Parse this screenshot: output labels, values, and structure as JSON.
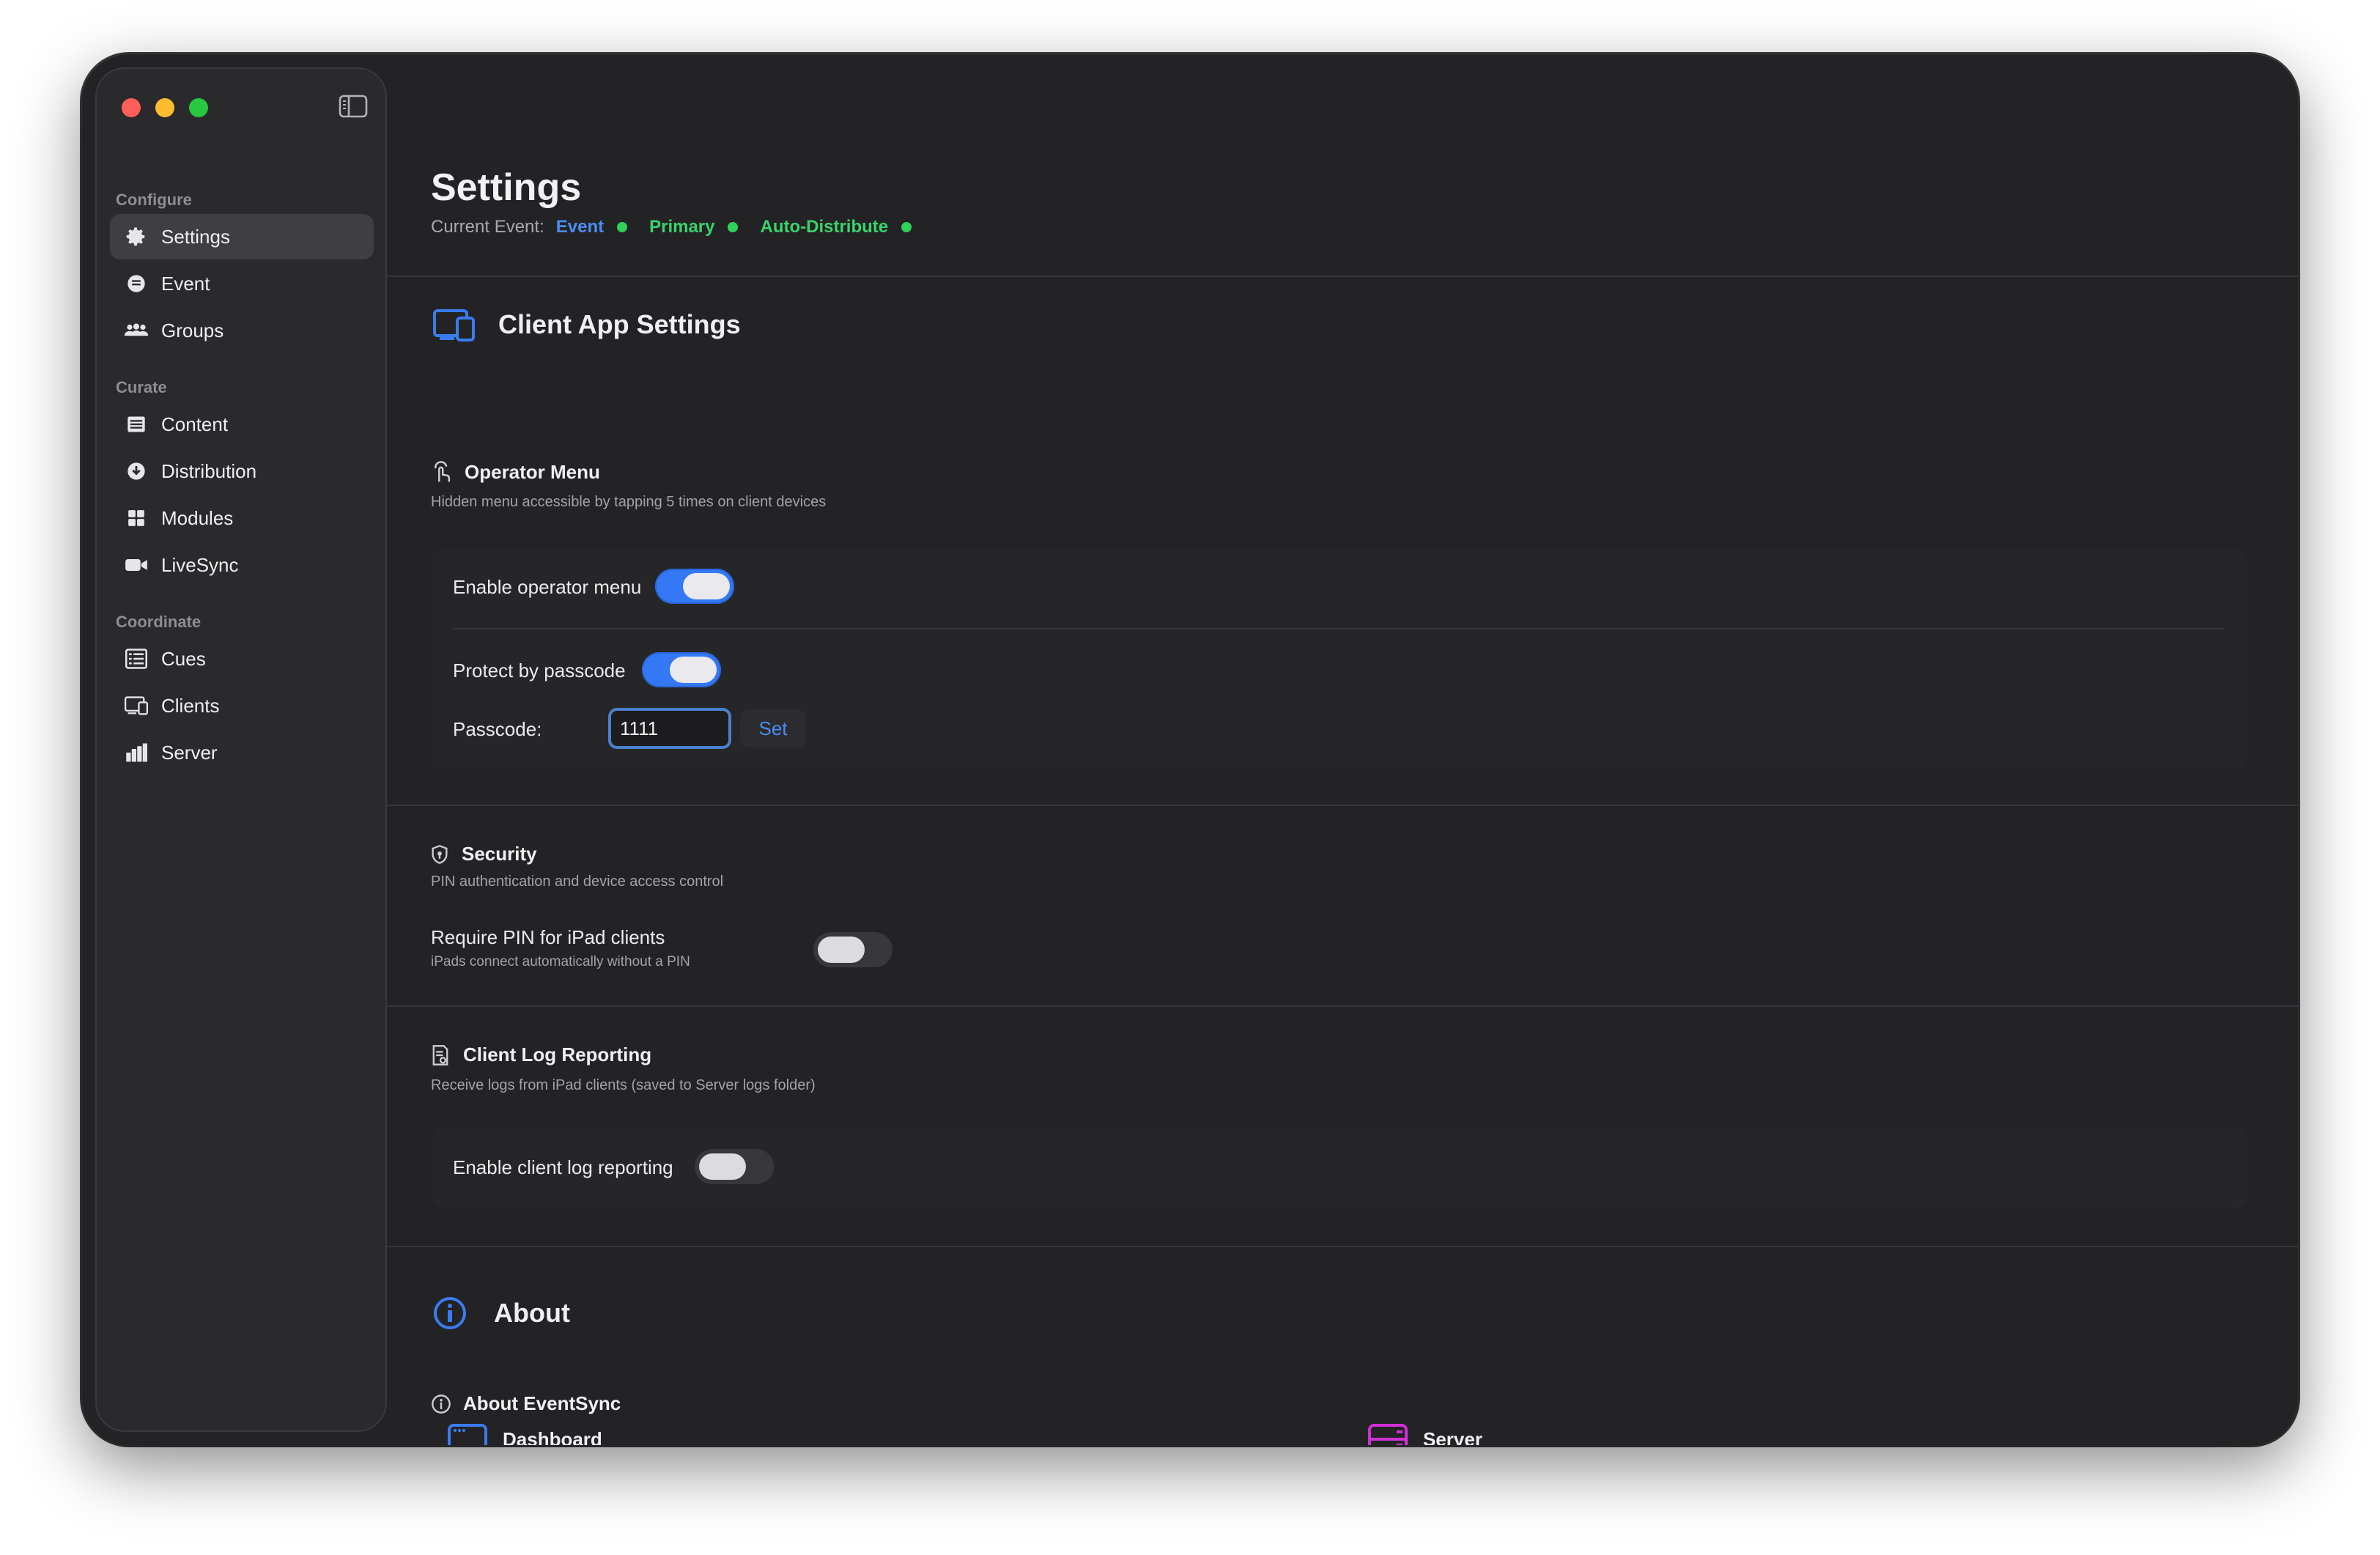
{
  "sidebar": {
    "sections": [
      {
        "label": "Configure",
        "items": [
          {
            "label": "Settings",
            "icon": "gear-icon",
            "active": true
          },
          {
            "label": "Event",
            "icon": "event-icon"
          },
          {
            "label": "Groups",
            "icon": "people-icon"
          }
        ]
      },
      {
        "label": "Curate",
        "items": [
          {
            "label": "Content",
            "icon": "content-icon"
          },
          {
            "label": "Distribution",
            "icon": "download-icon"
          },
          {
            "label": "Modules",
            "icon": "grid-icon"
          },
          {
            "label": "LiveSync",
            "icon": "video-icon"
          }
        ]
      },
      {
        "label": "Coordinate",
        "items": [
          {
            "label": "Cues",
            "icon": "list-icon"
          },
          {
            "label": "Clients",
            "icon": "clients-icon"
          },
          {
            "label": "Server",
            "icon": "chart-icon"
          }
        ]
      }
    ]
  },
  "header": {
    "title": "Settings",
    "current_event_label": "Current Event:",
    "tags": [
      {
        "text": "Event",
        "color": "#4b8cf5"
      },
      {
        "text": "Primary",
        "color": "#3ad36c"
      },
      {
        "text": "Auto-Distribute",
        "color": "#3ad36c"
      }
    ],
    "status_color": "#2fd158"
  },
  "client_app": {
    "title": "Client App Settings",
    "operator_menu": {
      "title": "Operator Menu",
      "description": "Hidden menu accessible by tapping 5 times on client devices",
      "enable_label": "Enable operator menu",
      "enable_on": true,
      "protect_label": "Protect by passcode",
      "protect_on": true,
      "passcode_label": "Passcode:",
      "passcode_value": "1111",
      "set_label": "Set"
    },
    "security": {
      "title": "Security",
      "description": "PIN authentication and device access control",
      "pin_label": "Require PIN for iPad clients",
      "pin_sublabel": "iPads connect automatically without a PIN",
      "pin_on": false
    },
    "log_reporting": {
      "title": "Client Log Reporting",
      "description": "Receive logs from iPad clients (saved to Server logs folder)",
      "enable_label": "Enable client log reporting",
      "enable_on": false
    }
  },
  "about": {
    "title": "About",
    "subtitle": "About EventSync",
    "cards": [
      {
        "label": "Dashboard",
        "icon": "dashboard-icon",
        "color": "#3b7bf0"
      },
      {
        "label": "Server",
        "icon": "server-icon",
        "color": "#d12fd6"
      }
    ]
  },
  "colors": {
    "accent": "#3478f6",
    "window_bg": "#232325",
    "sidebar_bg": "#2a2a2c"
  }
}
